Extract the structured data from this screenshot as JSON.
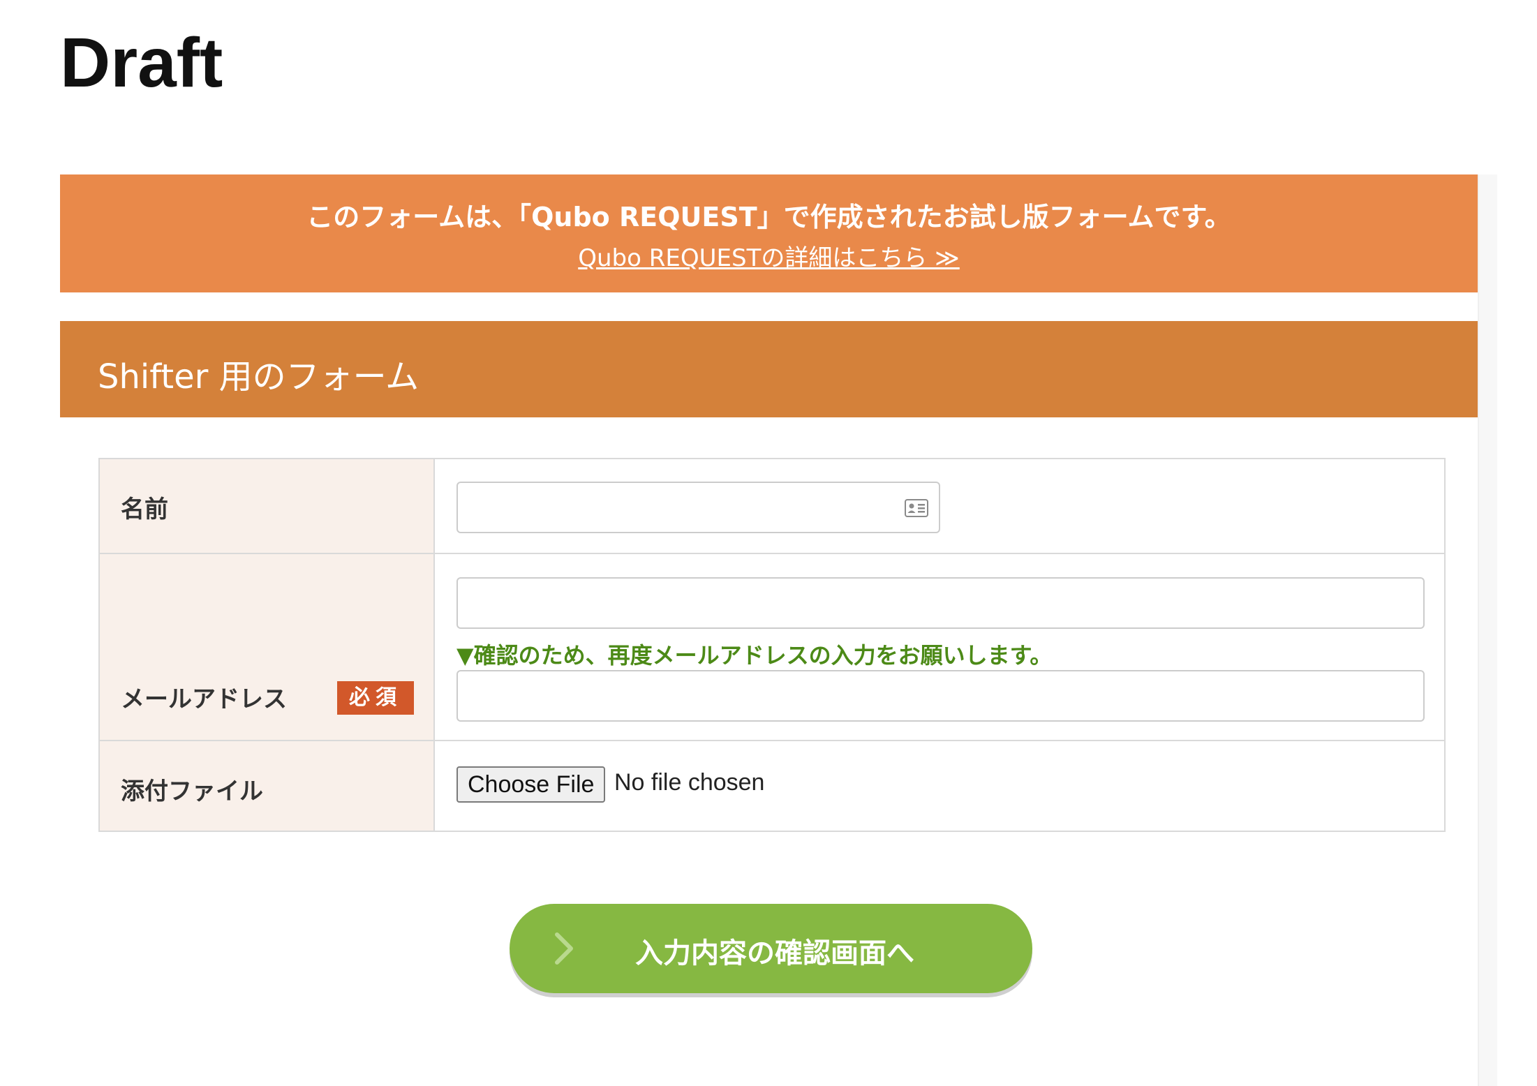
{
  "page": {
    "title": "Draft"
  },
  "notice": {
    "text": "このフォームは、「Qubo REQUEST」で作成されたお試し版フォームです。",
    "link_label": "Qubo REQUESTの詳細はこちら ≫"
  },
  "form": {
    "title": "Shifter 用のフォーム",
    "fields": {
      "name": {
        "label": "名前",
        "value": "",
        "icon": "contact-card-icon"
      },
      "email": {
        "label": "メールアドレス",
        "required_badge": "必須",
        "value": "",
        "confirm_note": "▼確認のため、再度メールアドレスの入力をお願いします。",
        "confirm_value": ""
      },
      "attachment": {
        "label": "添付ファイル",
        "button_label": "Choose File",
        "status": "No file chosen"
      }
    },
    "submit": {
      "label": "入力内容の確認画面へ",
      "icon": "chevron-right-icon"
    }
  },
  "colors": {
    "notice_bg": "#e9894a",
    "header_bg": "#d4813a",
    "label_bg": "#f9f0ea",
    "required_badge": "#d2582a",
    "note_text": "#4c8a17",
    "submit_bg": "#86b842"
  }
}
